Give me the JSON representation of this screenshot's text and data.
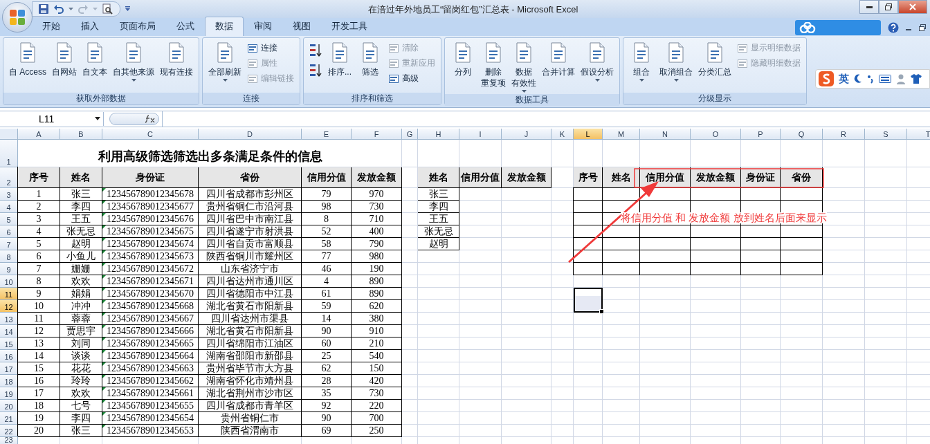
{
  "window": {
    "title": "在涪过年外地员工“留岗红包”汇总表 - Microsoft Excel"
  },
  "tabs": [
    {
      "label": "开始",
      "selected": false
    },
    {
      "label": "插入",
      "selected": false
    },
    {
      "label": "页面布局",
      "selected": false
    },
    {
      "label": "公式",
      "selected": false
    },
    {
      "label": "数据",
      "selected": true
    },
    {
      "label": "审阅",
      "selected": false
    },
    {
      "label": "视图",
      "selected": false
    },
    {
      "label": "开发工具",
      "selected": false
    }
  ],
  "ribbon_groups": [
    {
      "title": "获取外部数据",
      "items": [
        {
          "kind": "large",
          "label_lines": [
            "自 Access"
          ],
          "disabled": false
        },
        {
          "kind": "large",
          "label_lines": [
            "自网站"
          ],
          "disabled": false
        },
        {
          "kind": "large",
          "label_lines": [
            "自文本"
          ],
          "disabled": false
        },
        {
          "kind": "large",
          "label_lines": [
            "自其他来源"
          ],
          "disabled": false,
          "dropdown": true
        },
        {
          "kind": "large",
          "label_lines": [
            "现有连接"
          ],
          "disabled": false
        }
      ]
    },
    {
      "title": "连接",
      "items": [
        {
          "kind": "large",
          "label_lines": [
            "全部刷新"
          ],
          "disabled": false,
          "dropdown": true
        },
        {
          "kind": "small",
          "label_lines": [
            "连接"
          ],
          "disabled": false
        },
        {
          "kind": "small",
          "label_lines": [
            "属性"
          ],
          "disabled": true
        },
        {
          "kind": "small",
          "label_lines": [
            "编辑链接"
          ],
          "disabled": true
        }
      ]
    },
    {
      "title": "排序和筛选",
      "items": [
        {
          "kind": "icon",
          "disabled": false
        },
        {
          "kind": "icon",
          "disabled": false
        },
        {
          "kind": "large",
          "label_lines": [
            "排序..."
          ],
          "disabled": false
        },
        {
          "kind": "large",
          "label_lines": [
            "筛选"
          ],
          "disabled": false
        },
        {
          "kind": "small",
          "label_lines": [
            "清除"
          ],
          "disabled": true
        },
        {
          "kind": "small",
          "label_lines": [
            "重新应用"
          ],
          "disabled": true
        },
        {
          "kind": "small",
          "label_lines": [
            "高级"
          ],
          "disabled": false
        }
      ]
    },
    {
      "title": "数据工具",
      "items": [
        {
          "kind": "large",
          "label_lines": [
            "分列"
          ],
          "disabled": false
        },
        {
          "kind": "large",
          "label_lines": [
            "删除",
            "重复项"
          ],
          "disabled": false
        },
        {
          "kind": "large",
          "label_lines": [
            "数据",
            "有效性"
          ],
          "disabled": false,
          "dropdown": true
        },
        {
          "kind": "large",
          "label_lines": [
            "合并计算"
          ],
          "disabled": false
        },
        {
          "kind": "large",
          "label_lines": [
            "假设分析"
          ],
          "disabled": false,
          "dropdown": true
        }
      ]
    },
    {
      "title": "分级显示",
      "items": [
        {
          "kind": "large",
          "label_lines": [
            "组合"
          ],
          "disabled": false,
          "dropdown": true
        },
        {
          "kind": "large",
          "label_lines": [
            "取消组合"
          ],
          "disabled": false,
          "dropdown": true
        },
        {
          "kind": "large",
          "label_lines": [
            "分类汇总"
          ],
          "disabled": false
        },
        {
          "kind": "small",
          "label_lines": [
            "显示明细数据"
          ],
          "disabled": true
        },
        {
          "kind": "small",
          "label_lines": [
            "隐藏明细数据"
          ],
          "disabled": true
        }
      ]
    }
  ],
  "ime_bar": {
    "label": "英"
  },
  "name_box": "L11",
  "columns": [
    {
      "label": "A",
      "selected": false
    },
    {
      "label": "B",
      "selected": false
    },
    {
      "label": "C",
      "selected": false
    },
    {
      "label": "D",
      "selected": false
    },
    {
      "label": "E",
      "selected": false
    },
    {
      "label": "F",
      "selected": false
    },
    {
      "label": "G",
      "selected": false
    },
    {
      "label": "H",
      "selected": false
    },
    {
      "label": "I",
      "selected": false
    },
    {
      "label": "J",
      "selected": false
    },
    {
      "label": "K",
      "selected": false
    },
    {
      "label": "L",
      "selected": true
    },
    {
      "label": "M",
      "selected": false
    },
    {
      "label": "N",
      "selected": false
    },
    {
      "label": "O",
      "selected": false
    },
    {
      "label": "P",
      "selected": false
    },
    {
      "label": "Q",
      "selected": false
    },
    {
      "label": "R",
      "selected": false
    },
    {
      "label": "S",
      "selected": false
    },
    {
      "label": "T",
      "selected": false
    }
  ],
  "rows": [
    {
      "label": "1",
      "selected": false
    },
    {
      "label": "2",
      "selected": false
    },
    {
      "label": "3",
      "selected": false
    },
    {
      "label": "4",
      "selected": false
    },
    {
      "label": "5",
      "selected": false
    },
    {
      "label": "6",
      "selected": false
    },
    {
      "label": "7",
      "selected": false
    },
    {
      "label": "8",
      "selected": false
    },
    {
      "label": "9",
      "selected": false
    },
    {
      "label": "10",
      "selected": false
    },
    {
      "label": "11",
      "selected": true
    },
    {
      "label": "12",
      "selected": true
    },
    {
      "label": "13",
      "selected": false
    },
    {
      "label": "14",
      "selected": false
    },
    {
      "label": "15",
      "selected": false
    },
    {
      "label": "16",
      "selected": false
    },
    {
      "label": "17",
      "selected": false
    },
    {
      "label": "18",
      "selected": false
    },
    {
      "label": "19",
      "selected": false
    },
    {
      "label": "20",
      "selected": false
    },
    {
      "label": "21",
      "selected": false
    },
    {
      "label": "22",
      "selected": false
    },
    {
      "label": "23",
      "selected": false
    }
  ],
  "sheet_title": "利用高级筛选筛选出多条满足条件的信息",
  "main_table": {
    "columns": [
      "序号",
      "姓名",
      "身份证",
      "省份",
      "信用分值",
      "发放金额"
    ],
    "rows": [
      [
        "1",
        "张三",
        "123456789012345678",
        "四川省成都市彭州区",
        "79",
        "970"
      ],
      [
        "2",
        "李四",
        "123456789012345677",
        "贵州省铜仁市沿河县",
        "98",
        "730"
      ],
      [
        "3",
        "王五",
        "123456789012345676",
        "四川省巴中市南江县",
        "8",
        "710"
      ],
      [
        "4",
        "张无忌",
        "123456789012345675",
        "四川省遂宁市射洪县",
        "52",
        "400"
      ],
      [
        "5",
        "赵明",
        "123456789012345674",
        "四川省自贡市富顺县",
        "58",
        "790"
      ],
      [
        "6",
        "小鱼儿",
        "123456789012345673",
        "陕西省铜川市耀州区",
        "77",
        "980"
      ],
      [
        "7",
        "姗姗",
        "123456789012345672",
        "山东省济宁市",
        "46",
        "190"
      ],
      [
        "8",
        "欢欢",
        "123456789012345671",
        "四川省达州市通川区",
        "4",
        "890"
      ],
      [
        "9",
        "娟娟",
        "123456789012345670",
        "四川省德阳市中江县",
        "61",
        "890"
      ],
      [
        "10",
        "冲冲",
        "123456789012345668",
        "湖北省黄石市阳新县",
        "59",
        "620"
      ],
      [
        "11",
        "蓉蓉",
        "123456789012345667",
        "四川省达州市渠县",
        "14",
        "380"
      ],
      [
        "12",
        "贾思宇",
        "123456789012345666",
        "湖北省黄石市阳新县",
        "90",
        "910"
      ],
      [
        "13",
        "刘同",
        "123456789012345665",
        "四川省绵阳市江油区",
        "60",
        "210"
      ],
      [
        "14",
        "谈谈",
        "123456789012345664",
        "湖南省邵阳市新邵县",
        "25",
        "540"
      ],
      [
        "15",
        "花花",
        "123456789012345663",
        "贵州省毕节市大方县",
        "62",
        "150"
      ],
      [
        "16",
        "玲玲",
        "123456789012345662",
        "湖南省怀化市靖州县",
        "28",
        "420"
      ],
      [
        "17",
        "欢欢",
        "123456789012345661",
        "湖北省荆州市沙市区",
        "35",
        "730"
      ],
      [
        "18",
        "七号",
        "123456789012345655",
        "四川省成都市青羊区",
        "92",
        "220"
      ],
      [
        "19",
        "李四",
        "123456789012345654",
        "贵州省铜仁市",
        "90",
        "700"
      ],
      [
        "20",
        "张三",
        "123456789012345653",
        "陕西省渭南市",
        "69",
        "250"
      ]
    ]
  },
  "criteria_table": {
    "columns": [
      "姓名",
      "信用分值",
      "发放金额"
    ],
    "names": [
      "张三",
      "李四",
      "王五",
      "张无忌",
      "赵明"
    ]
  },
  "result_table": {
    "columns": [
      "序号",
      "姓名",
      "信用分值",
      "发放金额",
      "身份证",
      "省份"
    ]
  },
  "annotation": {
    "text": "将信用分值 和 发放金额 放到姓名后面来显示"
  }
}
